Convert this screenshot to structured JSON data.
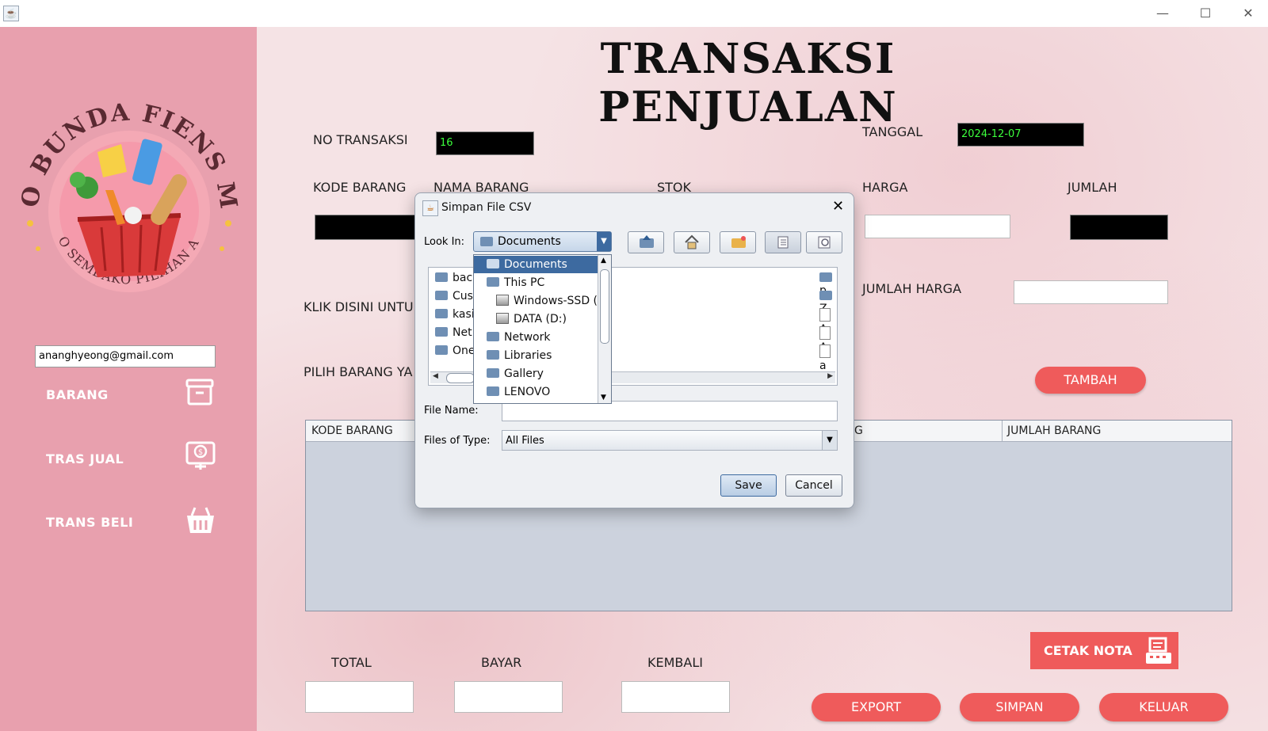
{
  "window": {
    "minimize": "—",
    "maximize": "☐",
    "close": "✕"
  },
  "brand": {
    "logo_top_text": "TOKO BUNDA FIENS MART",
    "logo_bottom_text": "TOKO SEMBAKO PILIHAN ANDA",
    "accent": "#ef5b5b",
    "sidebar_color": "#e8a0ae"
  },
  "sidebar": {
    "email": "ananghyeong@gmail.com",
    "items": [
      {
        "label": "BARANG",
        "icon": "archive-box-icon"
      },
      {
        "label": "TRAS JUAL",
        "icon": "cash-register-icon"
      },
      {
        "label": "TRANS BELI",
        "icon": "shopping-basket-icon"
      }
    ]
  },
  "main": {
    "title": "TRANSAKSI PENJUALAN",
    "no_transaksi_label": "NO TRANSAKSI",
    "no_transaksi_value": "16",
    "tanggal_label": "TANGGAL",
    "tanggal_value": "2024-12-07",
    "kode_barang_label": "KODE BARANG",
    "nama_barang_label": "NAMA BARANG",
    "stok_label": "STOK",
    "harga_label": "HARGA",
    "jumlah_label": "JUMLAH",
    "jumlah_harga_label": "JUMLAH HARGA",
    "klik_disini_label": "KLIK DISINI UNTU",
    "pilih_barang_label": "PILIH BARANG YA",
    "tambah_button": "TAMBAH",
    "table_headers": [
      "KODE BARANG",
      "G",
      "JUMLAH BARANG"
    ],
    "total_label": "TOTAL",
    "bayar_label": "BAYAR",
    "kembali_label": "KEMBALI",
    "cetak_nota_button": "CETAK NOTA",
    "export_button": "EXPORT",
    "simpan_button": "SIMPAN",
    "keluar_button": "KELUAR"
  },
  "dialog": {
    "title": "Simpan File CSV",
    "look_in_label": "Look In:",
    "look_in_value": "Documents",
    "dropdown_items": [
      {
        "label": "Documents",
        "type": "folder",
        "selected": true
      },
      {
        "label": "This PC",
        "type": "folder"
      },
      {
        "label": "Windows-SSD (C",
        "type": "drive"
      },
      {
        "label": "DATA (D:)",
        "type": "drive"
      },
      {
        "label": "Network",
        "type": "folder"
      },
      {
        "label": "Libraries",
        "type": "folder"
      },
      {
        "label": "Gallery",
        "type": "folder"
      },
      {
        "label": "LENOVO",
        "type": "folder"
      }
    ],
    "file_list_left": [
      "back",
      "Cust",
      "kasir",
      "NetB",
      "OneI"
    ],
    "file_list_right": [
      "p",
      "Z",
      "A",
      "A",
      "a"
    ],
    "file_name_label": "File Name:",
    "file_name_value": "",
    "files_of_type_label": "Files of Type:",
    "files_of_type_value": "All Files",
    "save_button": "Save",
    "cancel_button": "Cancel"
  }
}
